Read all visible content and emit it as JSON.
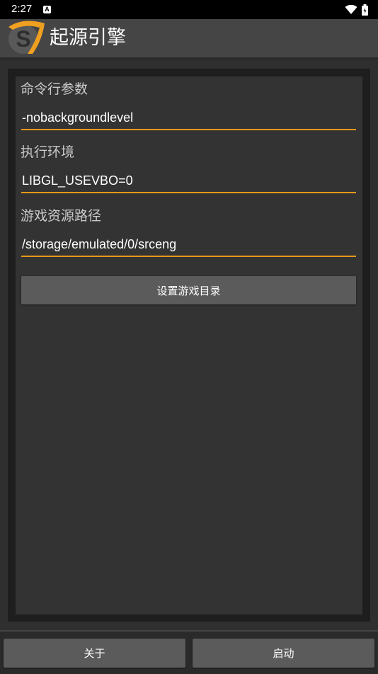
{
  "status_bar": {
    "time": "2:27",
    "notification_badge": "A",
    "icons": [
      "wifi-icon",
      "battery-icon"
    ]
  },
  "app_bar": {
    "title": "起源引擎",
    "logo_letter": "S",
    "logo_color": "#f0a020"
  },
  "form": {
    "cmd_args": {
      "label": "命令行参数",
      "value": "-nobackgroundlevel"
    },
    "exec_env": {
      "label": "执行环境",
      "value": "LIBGL_USEVBO=0"
    },
    "game_path": {
      "label": "游戏资源路径",
      "value": "/storage/emulated/0/srceng"
    },
    "set_dir_button": "设置游戏目录"
  },
  "bottom": {
    "about_button": "关于",
    "launch_button": "启动"
  },
  "colors": {
    "accent": "#e69a18",
    "background": "#2f2f2f",
    "panel": "#333333",
    "button": "#5b5b5b"
  }
}
